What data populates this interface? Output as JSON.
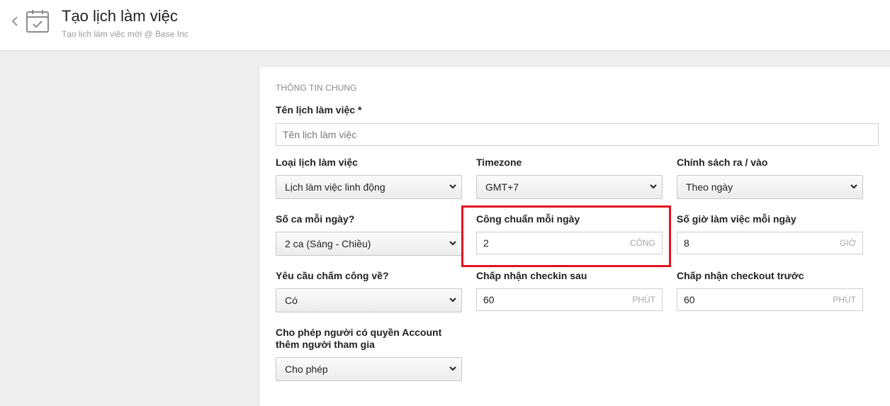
{
  "header": {
    "title": "Tạo lịch làm việc",
    "subtitle": "Tạo lịch làm việc mới @ Base Inc"
  },
  "form": {
    "section_title": "THÔNG TIN CHUNG",
    "name": {
      "label": "Tên lịch làm việc *",
      "placeholder": "Tên lịch làm việc",
      "value": ""
    },
    "schedule_type": {
      "label": "Loại lịch làm việc",
      "value": "Lịch làm việc linh động"
    },
    "timezone": {
      "label": "Timezone",
      "value": "GMT+7"
    },
    "policy": {
      "label": "Chính sách ra / vào",
      "value": "Theo ngày"
    },
    "shifts": {
      "label": "Số ca mỗi ngày?",
      "value": "2 ca (Sáng - Chiều)"
    },
    "standard_work": {
      "label": "Công chuẩn mỗi ngày",
      "value": "2",
      "unit": "CÔNG"
    },
    "hours_per_day": {
      "label": "Số giờ làm việc mỗi ngày",
      "value": "8",
      "unit": "GIỜ"
    },
    "checkout_required": {
      "label": "Yêu cầu chấm công về?",
      "value": "Có"
    },
    "checkin_after": {
      "label": "Chấp nhận checkin sau",
      "value": "60",
      "unit": "PHÚT"
    },
    "checkout_before": {
      "label": "Chấp nhận checkout trước",
      "value": "60",
      "unit": "PHÚT"
    },
    "allow_account": {
      "label": "Cho phép người có quyền Account thêm người tham gia",
      "value": "Cho phép"
    }
  },
  "colors": {
    "highlight": "#e0141e",
    "background": "#eeeeee"
  },
  "icons": {
    "back": "chevron-left-icon",
    "calendar": "calendar-check-icon",
    "select": "chevron-down-icon"
  }
}
